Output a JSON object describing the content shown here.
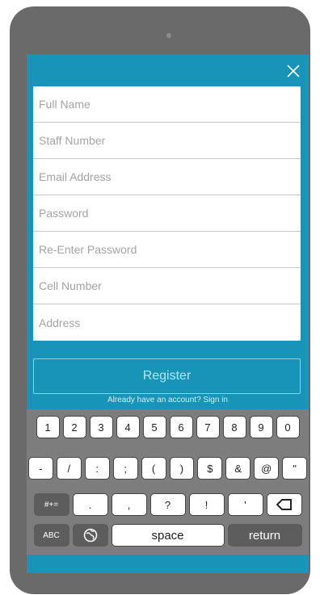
{
  "form": {
    "fields": [
      {
        "name": "full-name-field",
        "placeholder": "Full Name"
      },
      {
        "name": "staff-number-field",
        "placeholder": "Staff Number"
      },
      {
        "name": "email-address-field",
        "placeholder": "Email Address"
      },
      {
        "name": "password-field",
        "placeholder": "Password"
      },
      {
        "name": "re-enter-password-field",
        "placeholder": "Re-Enter Password"
      },
      {
        "name": "cell-number-field",
        "placeholder": "Cell Number"
      },
      {
        "name": "address-field",
        "placeholder": "Address"
      }
    ],
    "register_label": "Register",
    "signin_text": "Already have an account? Sign in"
  },
  "keyboard": {
    "row1": [
      "1",
      "2",
      "3",
      "4",
      "5",
      "6",
      "7",
      "8",
      "9",
      "0"
    ],
    "row2": [
      "-",
      "/",
      ":",
      ";",
      "(",
      ")",
      "$",
      "&",
      "@",
      "\""
    ],
    "row3": {
      "symbols_label": "#+=",
      "keys": [
        ".",
        ",",
        "?",
        "!",
        "'"
      ]
    },
    "row4": {
      "abc_label": "ABC",
      "space_label": "space",
      "return_label": "return"
    }
  },
  "icons": {
    "close": "close-icon",
    "backspace": "backspace-icon",
    "globe": "globe-icon"
  },
  "colors": {
    "accent": "#1794b8",
    "phone_body": "#6a6a6a",
    "keyboard_bg": "#7d7d7d"
  }
}
